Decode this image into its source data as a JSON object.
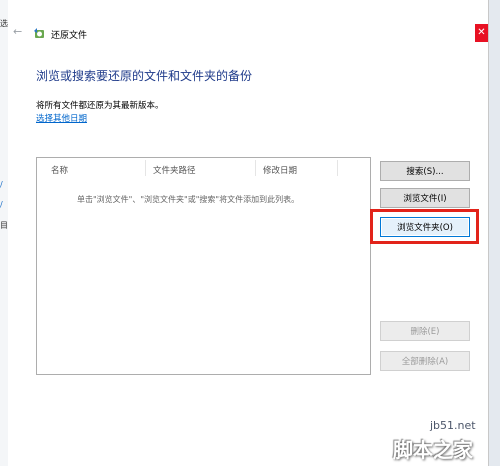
{
  "window": {
    "title": "还原文件"
  },
  "main": {
    "heading": "浏览或搜索要还原的文件和文件夹的备份",
    "subtext": "将所有文件都还原为其最新版本。",
    "choose_date_link": "选择其他日期"
  },
  "list": {
    "columns": [
      "名称",
      "文件夹路径",
      "修改日期"
    ],
    "empty_message": "单击\"浏览文件\"、\"浏览文件夹\"或\"搜索\"将文件添加到此列表。"
  },
  "buttons": {
    "search": "搜索(S)...",
    "browse_files": "浏览文件(I)",
    "browse_folders": "浏览文件夹(O)",
    "remove": "删除(E)",
    "remove_all": "全部删除(A)"
  },
  "watermark": {
    "url": "jb51.net",
    "logo_text": "脚本之家"
  },
  "background_window": {
    "fragments": [
      "选",
      "/",
      "/",
      "目"
    ]
  },
  "colors": {
    "heading": "#1e3a8a",
    "link": "#0066cc",
    "highlight_box": "#e2231a",
    "focus_border": "#0078d7"
  }
}
